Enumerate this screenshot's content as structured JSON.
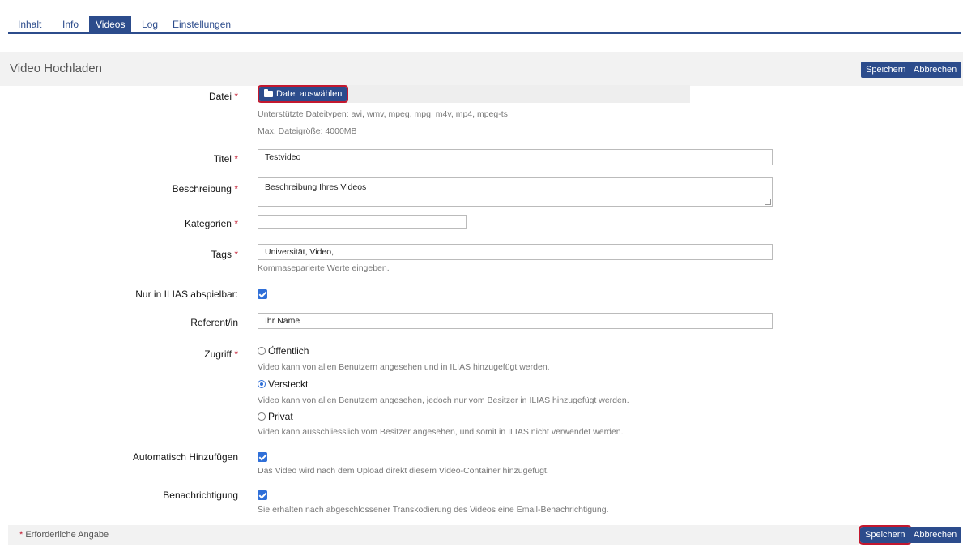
{
  "tabs": [
    {
      "label": "Inhalt"
    },
    {
      "label": "Info"
    },
    {
      "label": "Videos"
    },
    {
      "label": "Log"
    },
    {
      "label": "Einstellungen"
    }
  ],
  "page": {
    "title": "Video Hochladen"
  },
  "actions": {
    "save_label": "Speichern",
    "cancel_label": "Abbrechen"
  },
  "form": {
    "required_mark": "*",
    "file": {
      "label": "Datei",
      "button_label": "Datei auswählen",
      "help_types": "Unterstützte Dateitypen: avi, wmv, mpeg, mpg, m4v, mp4, mpeg-ts",
      "help_size": "Max. Dateigröße: 4000MB"
    },
    "title": {
      "label": "Titel",
      "value": "Testvideo"
    },
    "description": {
      "label": "Beschreibung",
      "value": "Beschreibung Ihres Videos"
    },
    "categories": {
      "label": "Kategorien",
      "value": ""
    },
    "tags": {
      "label": "Tags",
      "value": "Universität, Video,",
      "help": "Kommaseparierte Werte eingeben."
    },
    "ilias_only": {
      "label": "Nur in ILIAS abspielbar:",
      "checked": true
    },
    "speaker": {
      "label": "Referent/in",
      "value": "Ihr Name"
    },
    "access": {
      "label": "Zugriff",
      "options": [
        {
          "label": "Öffentlich",
          "help": "Video kann von allen Benutzern angesehen und in ILIAS hinzugefügt werden.",
          "checked": false
        },
        {
          "label": "Versteckt",
          "help": "Video kann von allen Benutzern angesehen, jedoch nur vom Besitzer in ILIAS hinzugefügt werden.",
          "checked": true
        },
        {
          "label": "Privat",
          "help": "Video kann ausschliesslich vom Besitzer angesehen, und somit in ILIAS nicht verwendet werden.",
          "checked": false
        }
      ]
    },
    "auto_add": {
      "label": "Automatisch Hinzufügen",
      "checked": true,
      "help": "Das Video wird nach dem Upload direkt diesem Video-Container hinzugefügt."
    },
    "notification": {
      "label": "Benachrichtigung",
      "checked": true,
      "help": "Sie erhalten nach abgeschlossener Transkodierung des Videos eine Email-Benachrichtigung."
    }
  },
  "footer": {
    "required_note": "Erforderliche Angabe"
  },
  "colors": {
    "primary": "#2c4c8c",
    "required": "#c3182f",
    "checkbox": "#2f6fd8"
  }
}
